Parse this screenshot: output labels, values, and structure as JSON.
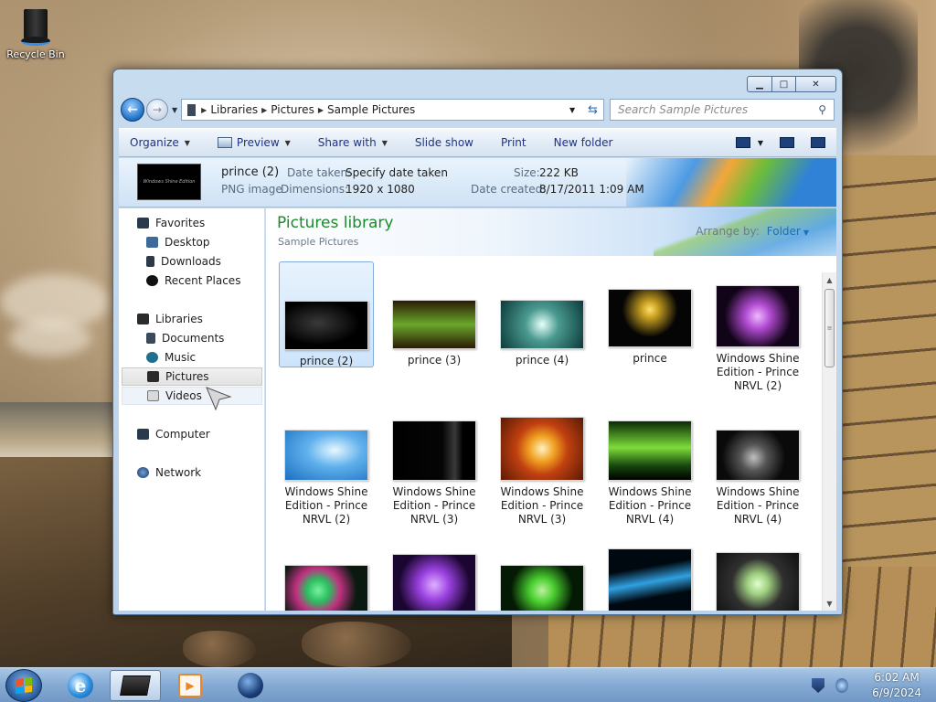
{
  "desktop": {
    "recycle_bin_label": "Recycle Bin"
  },
  "window": {
    "address": {
      "segments": [
        "Libraries",
        "Pictures",
        "Sample Pictures"
      ]
    },
    "search_placeholder": "Search Sample Pictures",
    "toolbar": {
      "organize": "Organize",
      "preview": "Preview",
      "share_with": "Share with",
      "slide_show": "Slide show",
      "print": "Print",
      "new_folder": "New folder"
    },
    "details": {
      "name": "prince (2)",
      "type": "PNG image",
      "date_taken_label": "Date taken:",
      "date_taken_value": "Specify date taken",
      "dimensions_label": "Dimensions:",
      "dimensions_value": "1920 x 1080",
      "size_label": "Size:",
      "size_value": "222 KB",
      "date_created_label": "Date created:",
      "date_created_value": "8/17/2011 1:09 AM",
      "thumb_text": "Windows Shine Edition"
    },
    "nav": {
      "favorites": "Favorites",
      "desktop": "Desktop",
      "downloads": "Downloads",
      "recent_places": "Recent Places",
      "libraries": "Libraries",
      "documents": "Documents",
      "music": "Music",
      "pictures": "Pictures",
      "videos": "Videos",
      "computer": "Computer",
      "network": "Network"
    },
    "library": {
      "title": "Pictures library",
      "subtitle": "Sample Pictures",
      "arrange_label": "Arrange by:",
      "arrange_value": "Folder"
    },
    "files": [
      {
        "name": "prince (2)",
        "colors": [
          "#000000",
          "#1a1a1a"
        ]
      },
      {
        "name": "prince (3)",
        "colors": [
          "#2b1a05",
          "#6aa82a"
        ]
      },
      {
        "name": "prince (4)",
        "colors": [
          "#0c3a3a",
          "#bfe8e0"
        ]
      },
      {
        "name": "prince",
        "colors": [
          "#050505",
          "#c9a021"
        ]
      },
      {
        "name": "Windows Shine Edition - Prince NRVL (2)",
        "colors": [
          "#120418",
          "#b04ad0"
        ]
      },
      {
        "name": "Windows Shine Edition - Prince NRVL (2)",
        "colors": [
          "#1a6fc0",
          "#c9ecff"
        ]
      },
      {
        "name": "Windows Shine Edition - Prince NRVL (3)",
        "colors": [
          "#000000",
          "#3a3a3a"
        ]
      },
      {
        "name": "Windows Shine Edition - Prince NRVL (3)",
        "colors": [
          "#5a1a05",
          "#f0a020"
        ]
      },
      {
        "name": "Windows Shine Edition - Prince NRVL (4)",
        "colors": [
          "#0a2a05",
          "#7ddc3a"
        ]
      },
      {
        "name": "Windows Shine Edition - Prince NRVL (4)",
        "colors": [
          "#0a0a0a",
          "#8a8a8a"
        ]
      },
      {
        "name": "",
        "colors": [
          "#0a1a10",
          "#2ac060"
        ]
      },
      {
        "name": "",
        "colors": [
          "#1a0630",
          "#9a40e0"
        ]
      },
      {
        "name": "",
        "colors": [
          "#041a04",
          "#4ad030"
        ]
      },
      {
        "name": "",
        "colors": [
          "#000810",
          "#30a0e0"
        ]
      },
      {
        "name": "",
        "colors": [
          "#101010",
          "#a0d080"
        ]
      }
    ]
  },
  "taskbar": {
    "time": "6:02 AM",
    "date": "6/9/2024"
  }
}
